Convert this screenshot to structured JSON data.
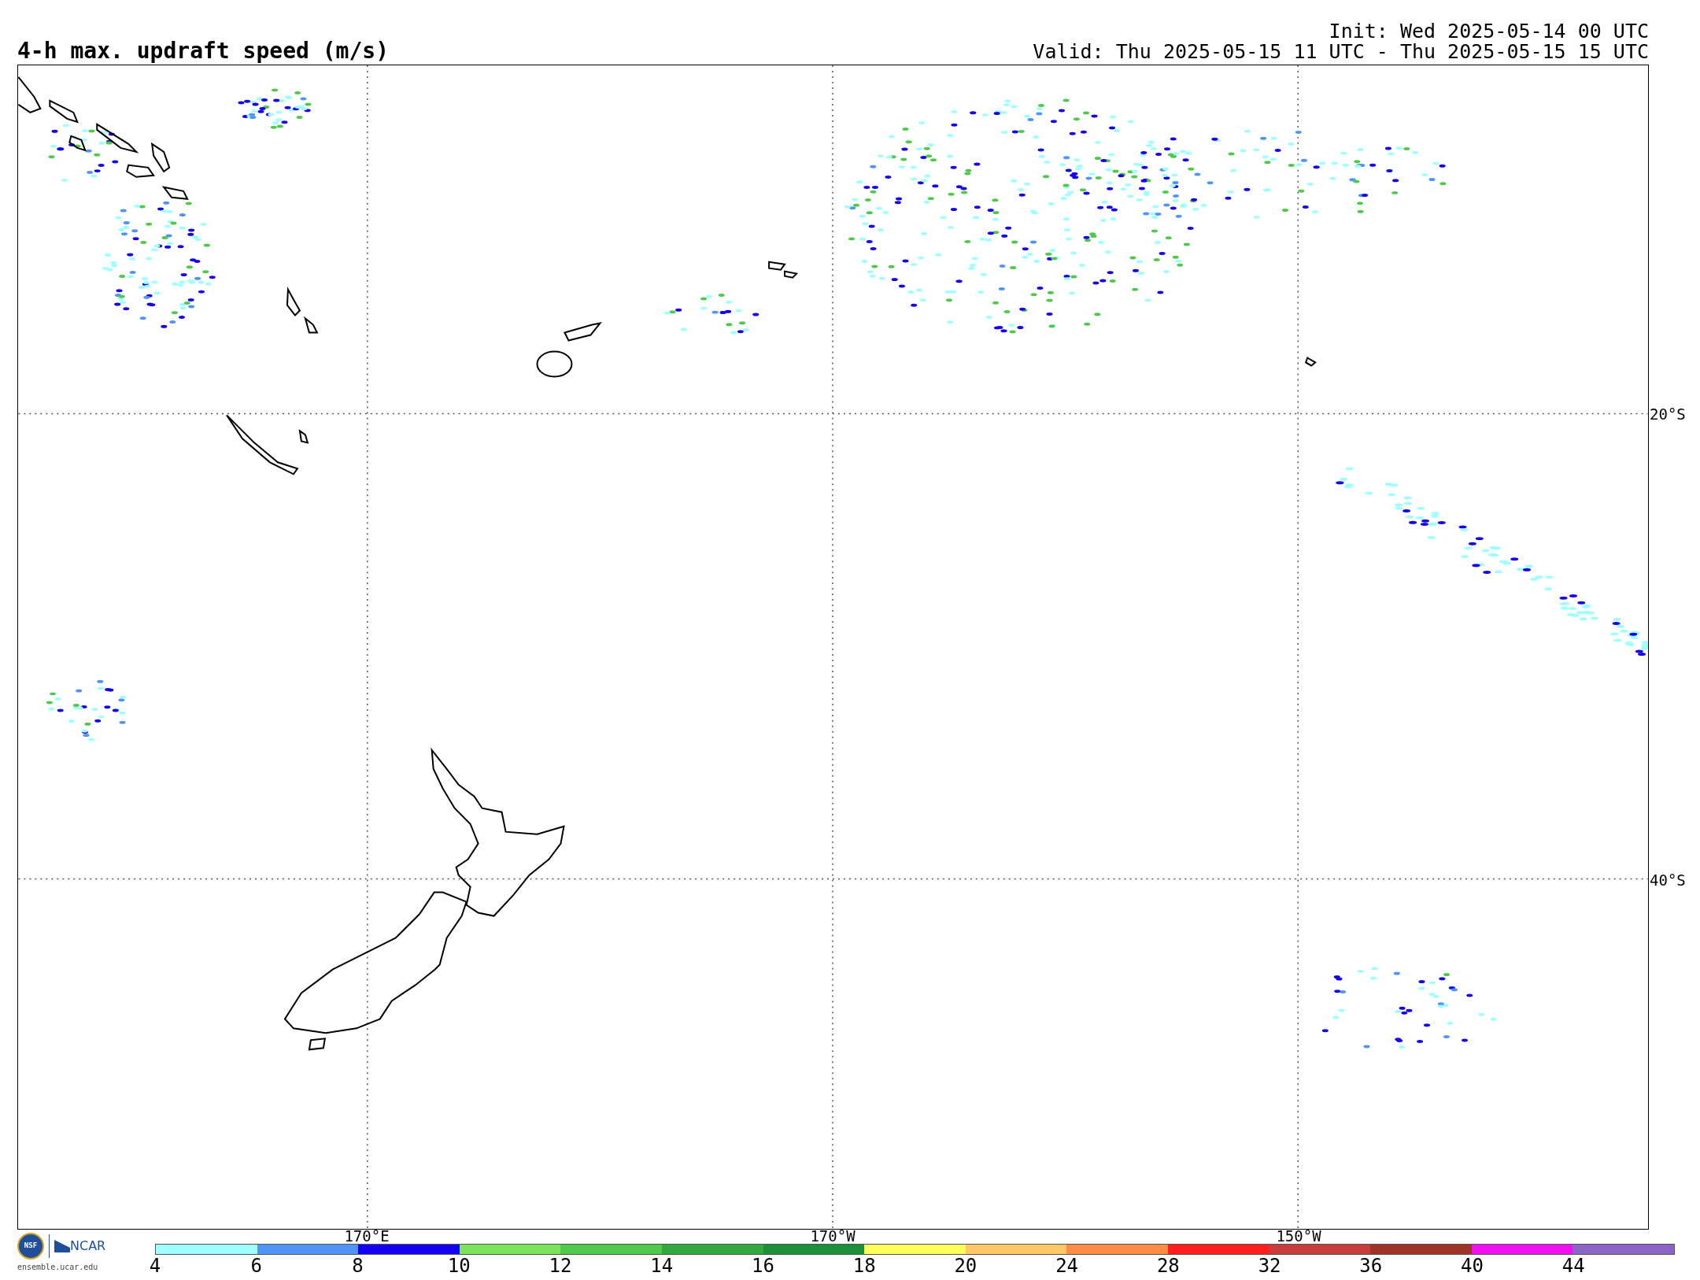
{
  "title": "4-h max. updraft speed (m/s)",
  "init": "Init: Wed 2025-05-14 00 UTC",
  "valid": "Valid: Thu 2025-05-15 11 UTC - Thu 2025-05-15 15 UTC",
  "map": {
    "latitude_labels": [
      "20°S",
      "40°S"
    ],
    "longitude_labels": [
      "170°E",
      "170°W",
      "150°W"
    ]
  },
  "colorbar": {
    "segments": [
      {
        "label": "4",
        "color": "#a0ffff"
      },
      {
        "label": "6",
        "color": "#4f94f7"
      },
      {
        "label": "8",
        "color": "#1400f0"
      },
      {
        "label": "10",
        "color": "#7ae35a"
      },
      {
        "label": "12",
        "color": "#4fc94a"
      },
      {
        "label": "14",
        "color": "#33a63d"
      },
      {
        "label": "16",
        "color": "#1c8f3b"
      },
      {
        "label": "18",
        "color": "#ffff5a"
      },
      {
        "label": "20",
        "color": "#ffc864"
      },
      {
        "label": "24",
        "color": "#ff8c46"
      },
      {
        "label": "28",
        "color": "#ff1e1e"
      },
      {
        "label": "32",
        "color": "#c83c3c"
      },
      {
        "label": "36",
        "color": "#a03228"
      },
      {
        "label": "40",
        "color": "#f00ff0"
      },
      {
        "label": "44",
        "color": "#8c64c8"
      }
    ]
  },
  "credits": {
    "nsf": "NSF",
    "ncar": "NCAR",
    "url": "ensemble.ucar.edu"
  }
}
